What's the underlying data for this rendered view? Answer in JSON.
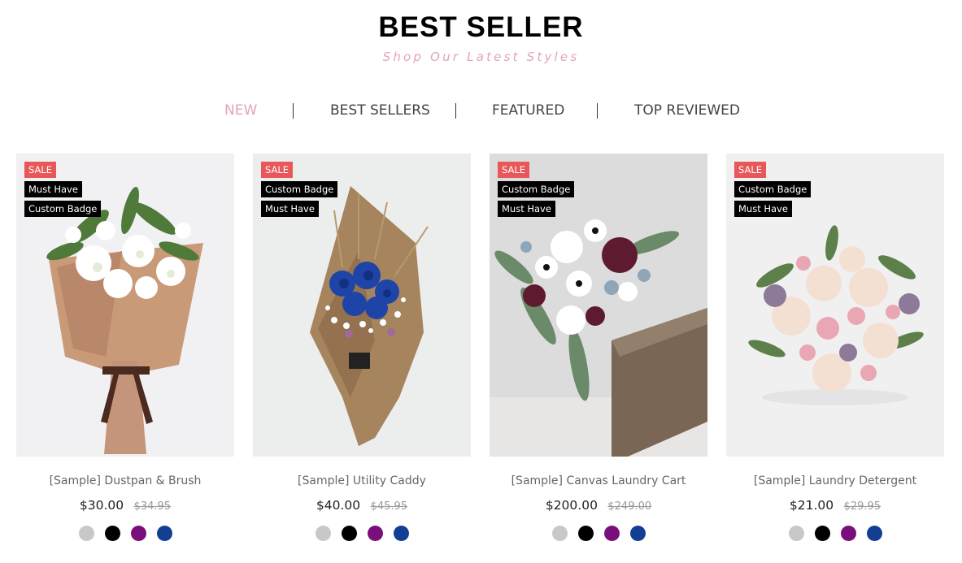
{
  "header": {
    "title": "BEST SELLER",
    "subtitle": "Shop Our Latest Styles"
  },
  "tabs": [
    {
      "label": "NEW",
      "active": true
    },
    {
      "label": "BEST SELLERS",
      "active": false
    },
    {
      "label": "FEATURED",
      "active": false
    },
    {
      "label": "TOP REVIEWED",
      "active": false
    }
  ],
  "products": [
    {
      "name": "[Sample] Dustpan & Brush",
      "price": "$30.00",
      "old_price": "$34.95",
      "badges": [
        "SALE",
        "Must Have",
        "Custom Badge"
      ],
      "image": "white-lily-bouquet-kraft-wrap"
    },
    {
      "name": "[Sample] Utility Caddy",
      "price": "$40.00",
      "old_price": "$45.95",
      "badges": [
        "SALE",
        "Custom Badge",
        "Must Have"
      ],
      "image": "blue-rose-bouquet-burlap-wrap"
    },
    {
      "name": "[Sample] Canvas Laundry Cart",
      "price": "$200.00",
      "old_price": "$249.00",
      "badges": [
        "SALE",
        "Custom Badge",
        "Must Have"
      ],
      "image": "burgundy-white-cascade-bouquet"
    },
    {
      "name": "[Sample] Laundry Detergent",
      "price": "$21.00",
      "old_price": "$29.95",
      "badges": [
        "SALE",
        "Custom Badge",
        "Must Have"
      ],
      "image": "pastel-rose-bridal-bouquet"
    }
  ],
  "swatch_colors": [
    "#c8c8c8",
    "#000000",
    "#7a0f7c",
    "#123f94"
  ],
  "colors": {
    "accent_pink": "#e3a3bf",
    "sale_red": "#e8585a",
    "badge_black": "#000000"
  }
}
